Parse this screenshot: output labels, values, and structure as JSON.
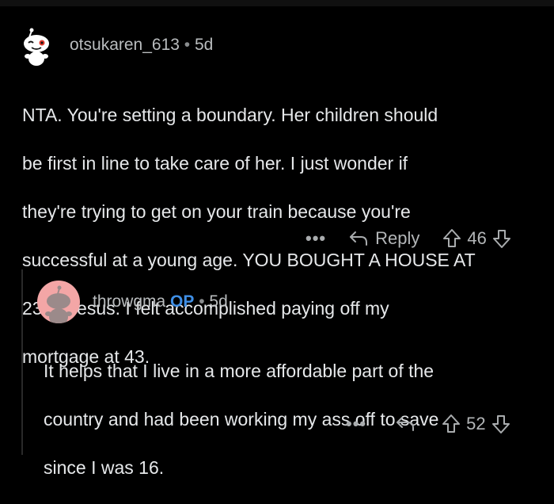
{
  "comment1": {
    "username": "otsukaren_613",
    "age": "5d",
    "lines": [
      "NTA.  You're setting a boundary.  Her children should",
      "be first in line to take care of her.  I just wonder if",
      "they're trying to get on your train because you're",
      "successful at a young age.  YOU BOUGHT A HOUSE AT",
      "23?!! Jesus. I felt accomplished paying off my",
      "mortgage at 43."
    ],
    "more_label": "•••",
    "reply_label": "Reply",
    "votes": "46"
  },
  "comment2": {
    "username": "throwgma",
    "op_badge": "OP",
    "age": "5d",
    "lines": [
      "It helps that I live in a more affordable part of the",
      "country and had been working my ass off to save",
      "since I was 16."
    ],
    "more_label": "•••",
    "votes": "52"
  },
  "colors": {
    "background": "#000000",
    "op_accent": "#3f8fe6",
    "avatar2_bg": "#f3a6a6"
  },
  "icons": [
    "snoo-avatar",
    "more-icon",
    "reply-arrow-icon",
    "upvote-icon",
    "downvote-icon"
  ]
}
